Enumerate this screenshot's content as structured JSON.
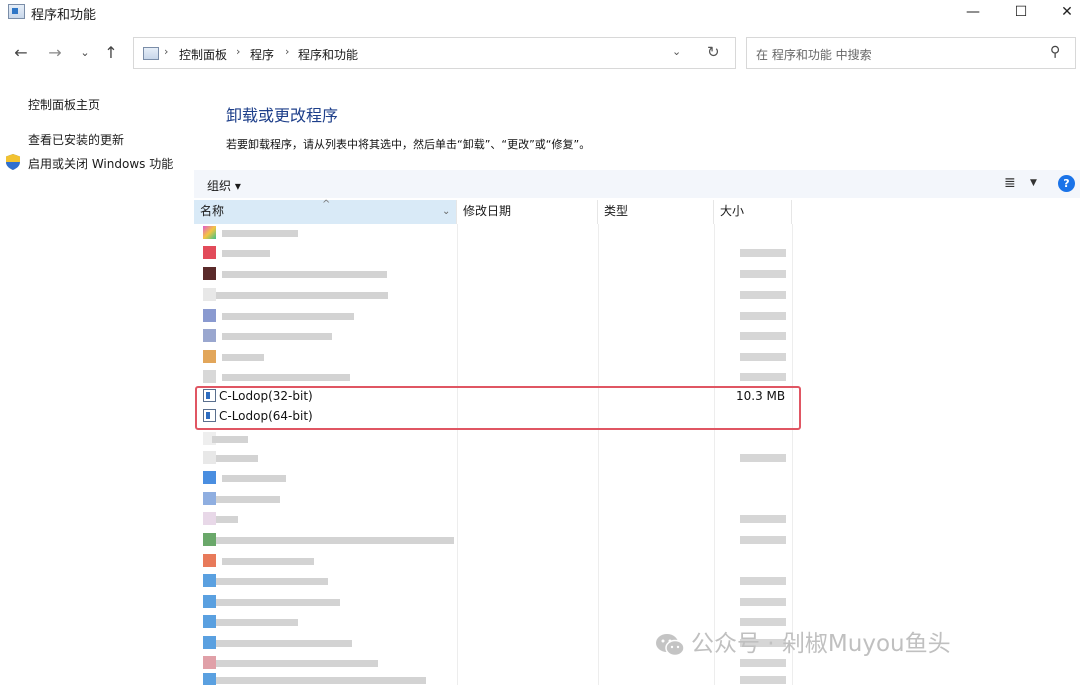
{
  "window": {
    "title": "程序和功能",
    "minimize": "—",
    "maximize": "☐",
    "close": "✕"
  },
  "nav": {
    "back": "←",
    "forward": "→",
    "recent": "⌄",
    "up": "↑",
    "breadcrumbs": [
      "控制面板",
      "程序",
      "程序和功能"
    ],
    "search_placeholder": "在 程序和功能 中搜索"
  },
  "sidebar": {
    "items": [
      {
        "label": "控制面板主页"
      },
      {
        "label": "查看已安装的更新"
      },
      {
        "label": "启用或关闭 Windows 功能"
      }
    ]
  },
  "main": {
    "title": "卸载或更改程序",
    "description": "若要卸载程序，请从列表中将其选中，然后单击“卸载”、“更改”或“修复”。"
  },
  "toolbar": {
    "organize_label": "组织 ▾",
    "help": "?"
  },
  "columns": {
    "name": "名称",
    "date": "修改日期",
    "type": "类型",
    "size": "大小"
  },
  "programs": [
    {
      "name": "C-Lodop(32-bit)",
      "size": "10.3 MB"
    },
    {
      "name": "C-Lodop(64-bit)",
      "size": ""
    }
  ],
  "watermark": "公众号 · 剁椒Muyou鱼头",
  "icons": [
    "window-icon",
    "search-icon",
    "refresh-icon",
    "shield-icon",
    "help-icon",
    "view-list-icon",
    "wechat-icon"
  ]
}
